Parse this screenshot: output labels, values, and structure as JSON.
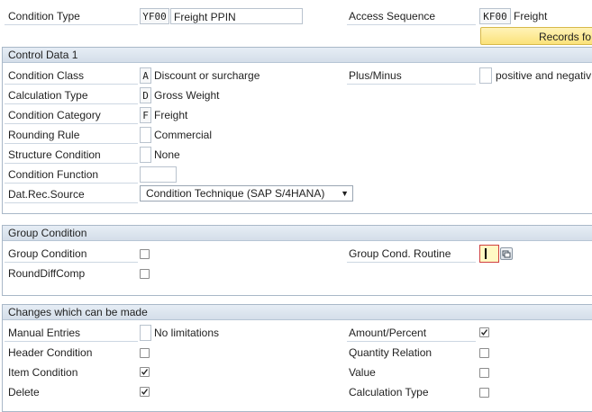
{
  "header": {
    "condition_type_label": "Condition Type",
    "condition_type_code": "YF00",
    "condition_type_desc": "Freight PPIN",
    "access_sequence_label": "Access Sequence",
    "access_sequence_code": "KF00",
    "access_sequence_desc": "Freight",
    "records_button": "Records fo"
  },
  "control_data": {
    "title": "Control Data 1",
    "condition_class_label": "Condition Class",
    "condition_class_code": "A",
    "condition_class_desc": "Discount or surcharge",
    "plus_minus_label": "Plus/Minus",
    "plus_minus_desc": "positive and negativ",
    "calculation_type_label": "Calculation Type",
    "calculation_type_code": "D",
    "calculation_type_desc": "Gross Weight",
    "condition_category_label": "Condition Category",
    "condition_category_code": "F",
    "condition_category_desc": "Freight",
    "rounding_rule_label": "Rounding Rule",
    "rounding_rule_code": "",
    "rounding_rule_desc": "Commercial",
    "structure_condition_label": "Structure Condition",
    "structure_condition_code": "",
    "structure_condition_desc": "None",
    "condition_function_label": "Condition Function",
    "condition_function_value": "",
    "dat_rec_source_label": "Dat.Rec.Source",
    "dat_rec_source_value": "Condition Technique (SAP S/4HANA)"
  },
  "group_condition": {
    "title": "Group Condition",
    "group_condition_label": "Group Condition",
    "group_condition_checked": false,
    "round_diff_comp_label": "RoundDiffComp",
    "round_diff_comp_checked": false,
    "group_cond_routine_label": "Group Cond. Routine",
    "group_cond_routine_value": ""
  },
  "changes": {
    "title": "Changes which can be made",
    "manual_entries_label": "Manual Entries",
    "manual_entries_code": "",
    "manual_entries_desc": "No limitations",
    "header_condition_label": "Header Condition",
    "header_condition_checked": false,
    "item_condition_label": "Item Condition",
    "item_condition_checked": true,
    "delete_label": "Delete",
    "delete_checked": true,
    "amount_percent_label": "Amount/Percent",
    "amount_percent_checked": true,
    "quantity_relation_label": "Quantity Relation",
    "quantity_relation_checked": false,
    "value_label": "Value",
    "value_checked": false,
    "calculation_type_label": "Calculation Type",
    "calculation_type_checked": false
  },
  "colors": {
    "section_header": "#d4dee9",
    "button_yellow": "#fbe27a",
    "focus_border": "#d04040"
  }
}
